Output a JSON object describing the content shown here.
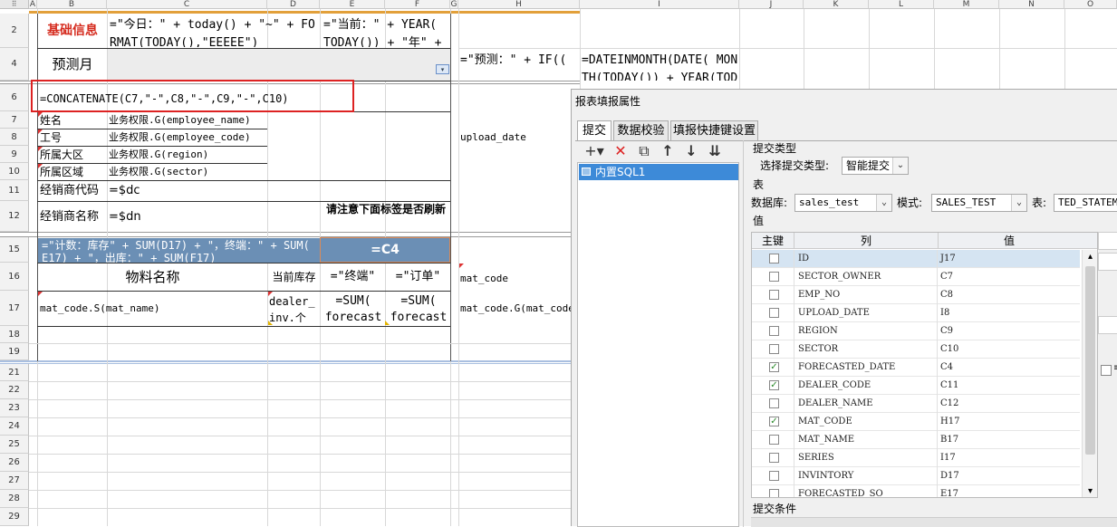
{
  "sheet": {
    "columns": [
      "A",
      "B",
      "C",
      "D",
      "E",
      "F",
      "G",
      "H",
      "I",
      "J",
      "K",
      "L",
      "M",
      "N",
      "O"
    ],
    "rows": [
      "2",
      "4",
      "6",
      "7",
      "8",
      "9",
      "10",
      "11",
      "12",
      "15",
      "16",
      "17",
      "18",
      "19",
      "21",
      "22",
      "23",
      "24",
      "25",
      "26",
      "27",
      "28",
      "29"
    ],
    "cells": {
      "b2": "基础信息",
      "c2": "=\"今日：\" + today() + \"~\" + FORMAT(TODAY(),\"EEEEE\")",
      "e2": "=\"当前：\" + YEAR( TODAY()) + \"年\" +",
      "b4": "预测月",
      "h4": "=\"预测：\" + IF((",
      "i4": "=DATEINMONTH(DATE( MONTH(TODAY()) + YEAR(TODAY()),MONTH(",
      "b6": "=CONCATENATE(C7,\"-\",C8,\"-\",C9,\"-\",C10)",
      "b7": "姓名",
      "c7": "业务权限.G(employee_name)",
      "b8": "工号",
      "c8": "业务权限.G(employee_code)",
      "h8": "upload_date",
      "b9": "所属大区",
      "c9": "业务权限.G(region)",
      "b10": "所属区域",
      "c10": "业务权限.G(sector)",
      "b11": "经销商代码",
      "c11": "=$dc",
      "b12": "经销商名称",
      "c12": "=$dn",
      "e12": "请注意下面标签是否刷新",
      "b15": "=\"计数：库存\" + SUM(D17) + \"，终端：\" + SUM( E17) + \"，出库：\" + SUM(F17)",
      "e15": "=C4",
      "b16": "物料名称",
      "d16": "当前库存",
      "e16": "=\"终端\"",
      "f16": "=\"订单\"",
      "h16": "mat_code",
      "b17": "mat_code.S(mat_name)",
      "d17": "dealer_inv.个",
      "e17": "=SUM( forecast",
      "f17": "=SUM( forecast",
      "h17": "mat_code.G(mat_code)"
    }
  },
  "dialog": {
    "title": "报表填报属性",
    "tabs": [
      "提交",
      "数据校验",
      "填报快捷键设置"
    ],
    "toolbar_icons": [
      "add-icon",
      "delete-icon",
      "copy-icon",
      "move-up-icon",
      "move-down-icon",
      "move-bottom-icon"
    ],
    "toolbar_glyphs": [
      "+▾",
      "✕",
      "⧉",
      "↑",
      "↓",
      "⇊"
    ],
    "sql_list": [
      "内置SQL1"
    ],
    "submit_type_heading": "提交类型",
    "select_type_label": "选择提交类型:",
    "select_type_value": "智能提交",
    "table_heading": "表",
    "db_label": "数据库:",
    "db_value": "sales_test",
    "schema_label": "模式:",
    "schema_value": "SALES_TEST",
    "table_label": "表:",
    "table_value": "TED_STATEME",
    "value_heading": "值",
    "grid_headers": [
      "主键",
      "列",
      "值"
    ],
    "grid_rows": [
      {
        "pk": false,
        "column": "ID",
        "value": "J17",
        "selected": true
      },
      {
        "pk": false,
        "column": "SECTOR_OWNER",
        "value": "C7"
      },
      {
        "pk": false,
        "column": "EMP_NO",
        "value": "C8"
      },
      {
        "pk": false,
        "column": "UPLOAD_DATE",
        "value": "I8"
      },
      {
        "pk": false,
        "column": "REGION",
        "value": "C9"
      },
      {
        "pk": false,
        "column": "SECTOR",
        "value": "C10"
      },
      {
        "pk": true,
        "column": "FORECASTED_DATE",
        "value": "C4"
      },
      {
        "pk": true,
        "column": "DEALER_CODE",
        "value": "C11"
      },
      {
        "pk": false,
        "column": "DEALER_NAME",
        "value": "C12"
      },
      {
        "pk": true,
        "column": "MAT_CODE",
        "value": "H17"
      },
      {
        "pk": false,
        "column": "MAT_NAME",
        "value": "B17"
      },
      {
        "pk": false,
        "column": "SERIES",
        "value": "I17"
      },
      {
        "pk": false,
        "column": "INVINTORY",
        "value": "D17"
      },
      {
        "pk": false,
        "column": "FORECASTED_SO",
        "value": "E17"
      }
    ],
    "submit_condition_heading": "提交条件",
    "side_checkbox_glyph": "≡"
  },
  "colors": {
    "highlight_border": "#d22",
    "orange_band": "#e2a03a",
    "header_fill": "#6b8fb5",
    "dialog_bg": "#f0f0f0",
    "red_title": "#d52b1e"
  }
}
